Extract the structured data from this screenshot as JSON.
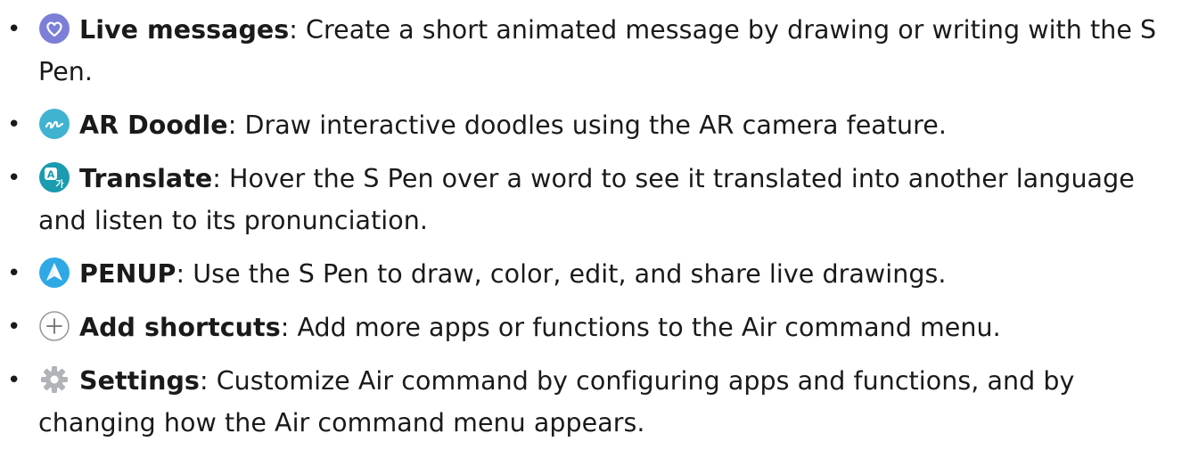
{
  "items": [
    {
      "icon": "live-messages-heart-icon",
      "term": "Live messages",
      "desc": ": Create a short animated message by drawing or writing with the S Pen."
    },
    {
      "icon": "ar-doodle-icon",
      "term": "AR Doodle",
      "desc": ": Draw interactive doodles using the AR camera feature."
    },
    {
      "icon": "translate-icon",
      "term": "Translate",
      "desc": ": Hover the S Pen over a word to see it translated into another language and listen to its pronunciation."
    },
    {
      "icon": "penup-icon",
      "term": "PENUP",
      "desc": ": Use the S Pen to draw, color, edit, and share live drawings."
    },
    {
      "icon": "add-plus-icon",
      "term": "Add shortcuts",
      "desc": ": Add more apps or functions to the Air command menu."
    },
    {
      "icon": "settings-gear-icon",
      "term": "Settings",
      "desc": ": Customize Air command by configuring apps and functions, and by changing how the Air command menu appears."
    }
  ],
  "colors": {
    "live_messages": "#7b7fd8",
    "ar_doodle": "#3fb3d1",
    "translate": "#1a9bb0",
    "penup": "#2fa8e6",
    "gear": "#b0b3b8",
    "plus": "#808080"
  }
}
